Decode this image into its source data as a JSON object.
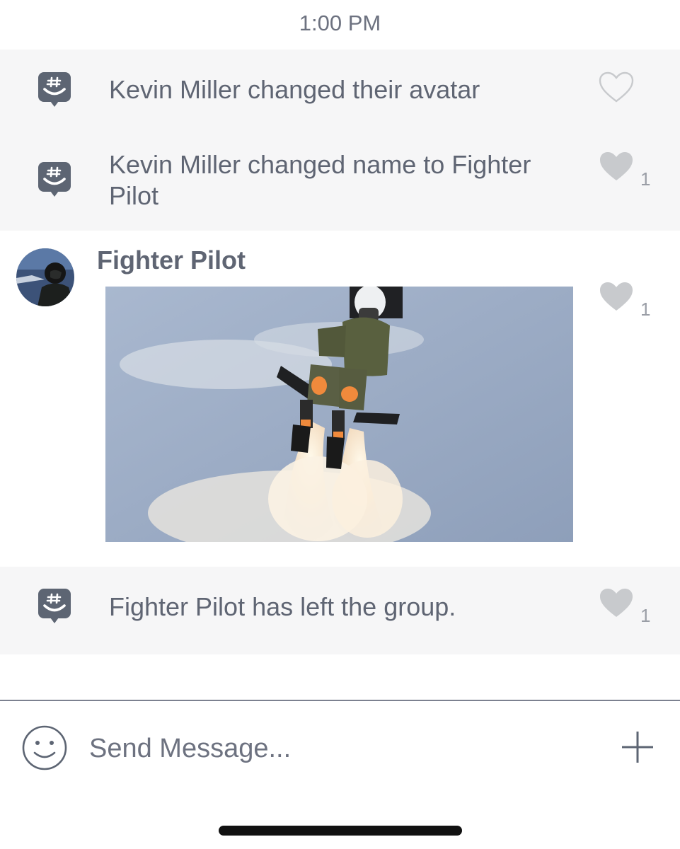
{
  "header": {
    "timestamp": "1:00 PM"
  },
  "messages": {
    "avatar_change": {
      "text": "Kevin Miller changed their avatar",
      "icon": "groupme-bot-icon",
      "liked": false
    },
    "name_change": {
      "text": "Kevin Miller changed name to Fighter Pilot",
      "icon": "groupme-bot-icon",
      "liked": true,
      "likes": "1"
    },
    "photo_post": {
      "author": "Fighter Pilot",
      "liked": true,
      "likes": "1"
    },
    "left_group": {
      "text": "Fighter Pilot has left the group.",
      "icon": "groupme-bot-icon",
      "liked": true,
      "likes": "1"
    }
  },
  "composer": {
    "placeholder": "Send Message...",
    "emoji_icon": "smiley-icon",
    "add_icon": "plus-icon"
  },
  "colors": {
    "system_row_bg": "#f6f6f7",
    "text": "#5f6573",
    "icon": "#5d6573",
    "heart_filled": "#c8cacd"
  }
}
